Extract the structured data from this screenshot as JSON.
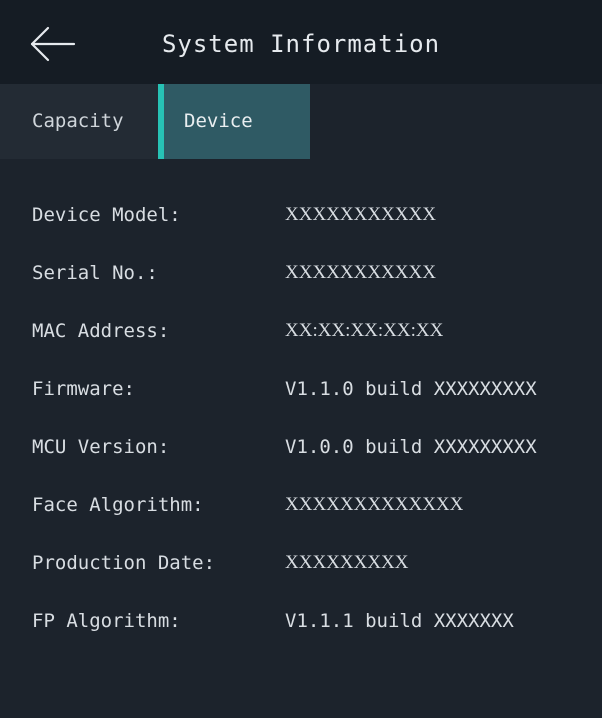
{
  "header": {
    "title": "System Information",
    "back_icon": "back-arrow-icon"
  },
  "tabs": [
    {
      "label": "Capacity",
      "selected": false
    },
    {
      "label": "Device",
      "selected": true
    }
  ],
  "colors": {
    "background": "#1c232c",
    "header_bg": "#151c24",
    "tab_selected_bg": "#2f5a64",
    "tab_selected_accent": "#27c2b5"
  },
  "device_info": [
    {
      "label": "Device Model:",
      "value": "XXXXXXXXXXX"
    },
    {
      "label": "Serial No.:",
      "value": "XXXXXXXXXXX"
    },
    {
      "label": "MAC Address:",
      "value": "XX:XX:XX:XX:XX"
    },
    {
      "label": "Firmware:",
      "value": "V1.1.0 build XXXXXXXXX"
    },
    {
      "label": "MCU Version:",
      "value": "V1.0.0 build XXXXXXXXX"
    },
    {
      "label": "Face Algorithm:",
      "value": "XXXXXXXXXXXXX"
    },
    {
      "label": "Production Date:",
      "value": "XXXXXXXXX"
    },
    {
      "label": "FP Algorithm:",
      "value": "V1.1.1 build XXXXXXX"
    }
  ]
}
